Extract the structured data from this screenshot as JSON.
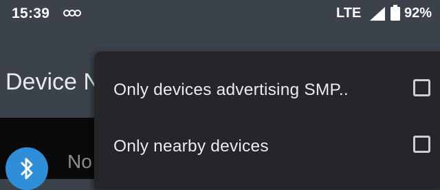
{
  "status_bar": {
    "time": "15:39",
    "network": "LTE",
    "battery": "92%",
    "icons": [
      "notification-icon",
      "signal-icon",
      "battery-icon"
    ]
  },
  "app_bar": {
    "title": "Device N"
  },
  "device_list": {
    "first_item_name": "No",
    "avatar_icon": "bluetooth-icon",
    "avatar_color": "#2f8ed8"
  },
  "menu": {
    "items": [
      {
        "label": "Only devices advertising SMP..",
        "checked": false
      },
      {
        "label": "Only nearby devices",
        "checked": false
      }
    ]
  },
  "colors": {
    "app_bar": "#3b424b",
    "menu_background": "#26252a",
    "content_background": "#0a0a0b"
  }
}
